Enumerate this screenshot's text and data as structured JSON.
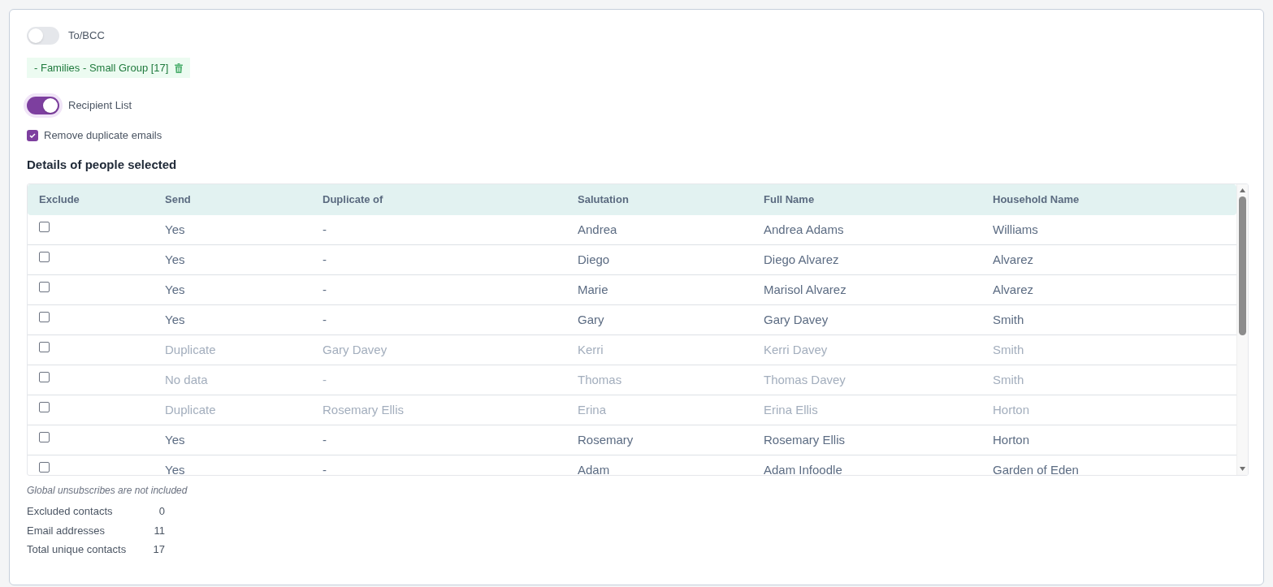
{
  "to_bcc": {
    "label": "To/BCC",
    "on": false
  },
  "group_tags": [
    {
      "label": "- Families - Small Group [17]"
    }
  ],
  "recipient_list": {
    "label": "Recipient List",
    "on": true
  },
  "remove_duplicates": {
    "label": "Remove duplicate emails",
    "checked": true
  },
  "details": {
    "title": "Details of people selected",
    "table": {
      "exclude_column": "Exclude",
      "columns": [
        "Send",
        "Duplicate of",
        "Salutation",
        "Full Name",
        "Household Name"
      ],
      "rows": [
        {
          "excluded": false,
          "muted": false,
          "cells": [
            "Yes",
            "-",
            "Andrea",
            "Andrea Adams",
            "Williams"
          ]
        },
        {
          "excluded": false,
          "muted": false,
          "cells": [
            "Yes",
            "-",
            "Diego",
            "Diego Alvarez",
            "Alvarez"
          ]
        },
        {
          "excluded": false,
          "muted": false,
          "cells": [
            "Yes",
            "-",
            "Marie",
            "Marisol Alvarez",
            "Alvarez"
          ]
        },
        {
          "excluded": false,
          "muted": false,
          "cells": [
            "Yes",
            "-",
            "Gary",
            "Gary Davey",
            "Smith"
          ]
        },
        {
          "excluded": false,
          "muted": true,
          "cells": [
            "Duplicate",
            "Gary Davey",
            "Kerri",
            "Kerri Davey",
            "Smith"
          ]
        },
        {
          "excluded": false,
          "muted": true,
          "cells": [
            "No data",
            "-",
            "Thomas",
            "Thomas Davey",
            "Smith"
          ]
        },
        {
          "excluded": false,
          "muted": true,
          "cells": [
            "Duplicate",
            "Rosemary Ellis",
            "Erina",
            "Erina Ellis",
            "Horton"
          ]
        },
        {
          "excluded": false,
          "muted": false,
          "cells": [
            "Yes",
            "-",
            "Rosemary",
            "Rosemary Ellis",
            "Horton"
          ]
        },
        {
          "excluded": false,
          "muted": false,
          "cells": [
            "Yes",
            "-",
            "Adam",
            "Adam Infoodle",
            "Garden of Eden"
          ]
        }
      ]
    },
    "note": "Global unsubscribes are not included",
    "stats": [
      {
        "label": "Excluded contacts",
        "value": "0"
      },
      {
        "label": "Email addresses",
        "value": "11"
      },
      {
        "label": "Total unique contacts",
        "value": "17"
      }
    ]
  }
}
